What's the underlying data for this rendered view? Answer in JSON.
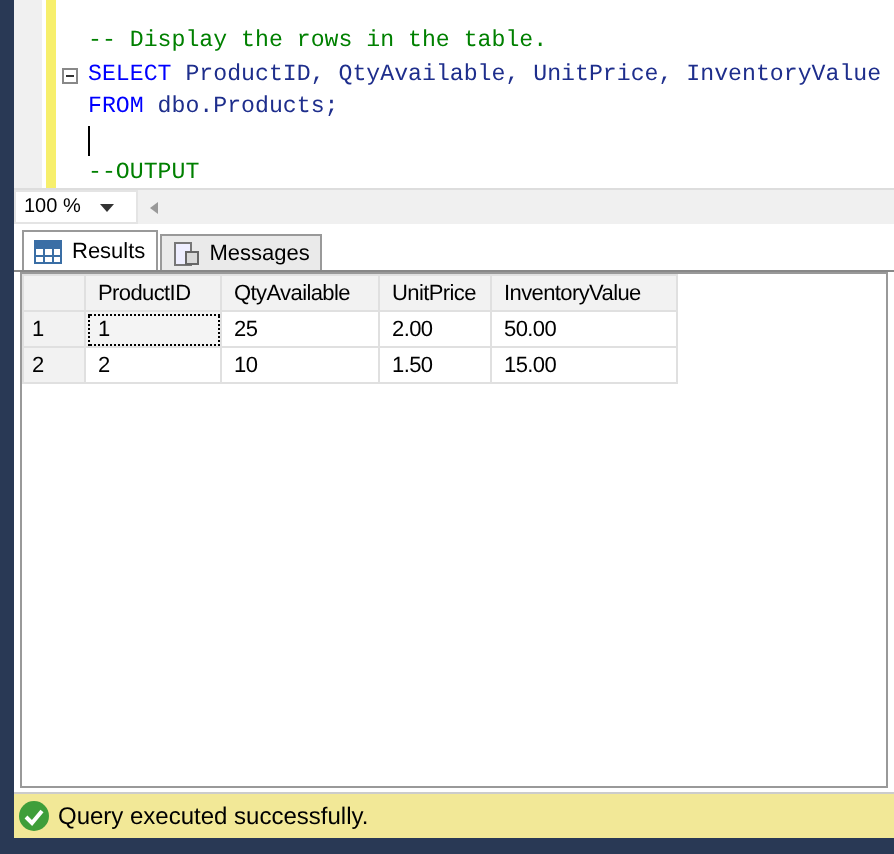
{
  "editor": {
    "lines": [
      {
        "kind": "code",
        "segments": [
          {
            "kind": "comment",
            "text": "-- Display the rows in the table."
          }
        ]
      },
      {
        "kind": "fold",
        "segments": [
          {
            "kind": "keyword",
            "text": "SELECT"
          },
          {
            "kind": "plain",
            "text": " ProductID, QtyAvailable, UnitPrice, InventoryValue"
          }
        ]
      },
      {
        "kind": "code",
        "segments": [
          {
            "kind": "keyword",
            "text": "FROM"
          },
          {
            "kind": "plain",
            "text": " dbo.Products;"
          }
        ]
      },
      {
        "kind": "cursor"
      },
      {
        "kind": "code",
        "segments": [
          {
            "kind": "comment",
            "text": "--OUTPUT"
          }
        ]
      }
    ]
  },
  "zoom": {
    "value": "100 %"
  },
  "tabs": [
    {
      "label": "Results",
      "kind": "grid",
      "selected": true
    },
    {
      "label": "Messages",
      "kind": "messages",
      "selected": false
    }
  ],
  "table": {
    "columns": [
      "ProductID",
      "QtyAvailable",
      "UnitPrice",
      "InventoryValue"
    ],
    "rows": [
      {
        "number": "1",
        "cells": [
          {
            "text": "1",
            "focused": true
          },
          {
            "text": "25",
            "focused": false
          },
          {
            "text": "2.00",
            "focused": false
          },
          {
            "text": "50.00",
            "focused": false
          }
        ]
      },
      {
        "number": "2",
        "cells": [
          {
            "text": "2",
            "focused": false
          },
          {
            "text": "10",
            "focused": false
          },
          {
            "text": "1.50",
            "focused": false
          },
          {
            "text": "15.00",
            "focused": false
          }
        ]
      }
    ]
  },
  "status_bar": {
    "message": "Query executed successfully."
  }
}
